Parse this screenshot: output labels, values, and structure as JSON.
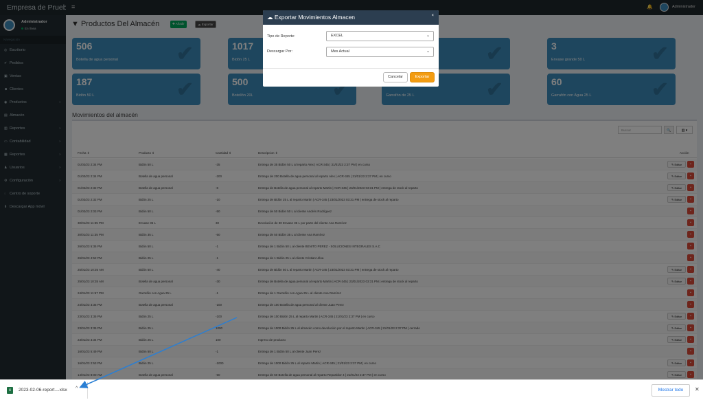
{
  "app": {
    "brand": "Empresa de Prueba",
    "user": "Administrador",
    "status": "En línea",
    "topbar_user": "Administrador"
  },
  "icons": {
    "menu": "menu-icon",
    "bell": "bell-icon",
    "check": "check-icon",
    "close": "close-icon",
    "excel": "excel-file-icon"
  },
  "colors": {
    "sidebar": "#222d32",
    "card": "#3c8dbc",
    "export": "#f39c12",
    "delete": "#dd4b39",
    "modal_header": "#2c3e50"
  },
  "sidebar": {
    "header": "Navegación",
    "items": [
      {
        "label": "Escritorio",
        "icon": "◎",
        "caret": ""
      },
      {
        "label": "Pedidos",
        "icon": "✔",
        "caret": ""
      },
      {
        "label": "Ventas",
        "icon": "▣",
        "caret": ""
      },
      {
        "label": "Clientes",
        "icon": "☻",
        "caret": ""
      },
      {
        "label": "Productos",
        "icon": "◉",
        "caret": "›"
      },
      {
        "label": "Almacén",
        "icon": "▤",
        "caret": ""
      },
      {
        "label": "Reportes",
        "icon": "▥",
        "caret": "›"
      },
      {
        "label": "Contabilidad",
        "icon": "▭",
        "caret": "›"
      },
      {
        "label": "Reportes",
        "icon": "▦",
        "caret": "›"
      },
      {
        "label": "Usuarios",
        "icon": "♟",
        "caret": "›"
      },
      {
        "label": "Configuración",
        "icon": "⚙",
        "caret": "›"
      },
      {
        "label": "Centro de soporte",
        "icon": "◌",
        "caret": ""
      },
      {
        "label": "Descargar App móvil",
        "icon": "⬇",
        "caret": ""
      }
    ]
  },
  "page": {
    "title": "Productos Del Almacén",
    "add_label": "✚ Añadir",
    "export_label": "☁ Exportar",
    "section_title": "Movimientos del almacén"
  },
  "cards": [
    {
      "value": "506",
      "label": "Botella de agua personal"
    },
    {
      "value": "1017",
      "label": "Bidón 25 L"
    },
    {
      "value": "",
      "label": ""
    },
    {
      "value": "3",
      "label": "Envase grande 50 L"
    },
    {
      "value": "187",
      "label": "Bidón 50 L"
    },
    {
      "value": "500",
      "label": "Botellón 20L"
    },
    {
      "value": "",
      "label": "Garrafón de 25 L"
    },
    {
      "value": "60",
      "label": "Garrafón con Agua 25 L"
    }
  ],
  "table": {
    "search_placeholder": "Buscar",
    "search_button": "🔍",
    "columns_button": "▥ ▾",
    "headers": {
      "fecha": "Fecha ⇕",
      "producto": "Producto ⇕",
      "cantidad": "Cantidad ⇕",
      "descripcion": "Descripcion ⇕",
      "accion": "Acción"
    },
    "edit_label": "✎ Editar",
    "delete_label": "▪",
    "rows": [
      {
        "fecha": "01/02/23 2:34 PM",
        "producto": "Bidón 50 L",
        "cantidad": "-35",
        "descripcion": "Entrega de 35 Bidón 50 L al reparto Alex | ACR-345 | 31/01/23 2:37 PM | en curso",
        "edit": true
      },
      {
        "fecha": "01/02/23 2:34 PM",
        "producto": "Botella de agua personal",
        "cantidad": "-200",
        "descripcion": "Entrega de 200 Botella de agua personal al reparto Alex | ACR-345 | 31/01/23 2:37 PM | en curso",
        "edit": true
      },
      {
        "fecha": "01/02/23 2:32 PM",
        "producto": "Botella de agua personal",
        "cantidad": "-8",
        "descripcion": "Entrega de Botella de agua personal al reparto Martin | ACR-345 | 23/01/2023 03:31 PM | entrega de stock al reparto",
        "edit": true
      },
      {
        "fecha": "01/02/23 2:32 PM",
        "producto": "Bidón 25 L",
        "cantidad": "-10",
        "descripcion": "Entrega de Bidón 25 L al reparto Martin | ACR-345 | 23/01/2023 03:31 PM | entrega de stock al reparto",
        "edit": true
      },
      {
        "fecha": "01/02/23 2:03 PM",
        "producto": "Bidón 50 L",
        "cantidad": "-50",
        "descripcion": "Entrega de 50 Bidón 50 L al cliente Andrés Rodríguez",
        "edit": false
      },
      {
        "fecha": "30/01/23 11:35 PM",
        "producto": "Envase 35 L",
        "cantidad": "30",
        "descripcion": "Devolución de 30 Envase 35 L por parte del cliente Ana Ramírez",
        "edit": false
      },
      {
        "fecha": "30/01/23 11:35 PM",
        "producto": "Bidón 35 L",
        "cantidad": "-50",
        "descripcion": "Entrega de 50 Bidón 35 L al cliente Ana Ramírez",
        "edit": false
      },
      {
        "fecha": "26/01/23 5:35 PM",
        "producto": "Bidón 50 L",
        "cantidad": "-1",
        "descripcion": "Entrega de 1 Bidón 50 L al cliente BENITO PEREZ - SOLUCIONES INTEGRALES S.A.C",
        "edit": false
      },
      {
        "fecha": "26/01/23 4:52 PM",
        "producto": "Bidón 25 L",
        "cantidad": "-1",
        "descripcion": "Entrega de 1 Bidón 25 L al cliente Cristian Ulloa",
        "edit": false
      },
      {
        "fecha": "25/01/23 10:35 AM",
        "producto": "Bidón 50 L",
        "cantidad": "-40",
        "descripcion": "Entrega de Bidón 50 L al reparto Martin | ACR-345 | 23/01/2023 03:31 PM | entrega de stock al reparto",
        "edit": true
      },
      {
        "fecha": "25/01/23 10:35 AM",
        "producto": "Botella de agua personal",
        "cantidad": "-30",
        "descripcion": "Entrega de Botella de agua personal al reparto Martin | ACR-345 | 23/01/2023 03:31 PM | entrega de stock al reparto",
        "edit": true
      },
      {
        "fecha": "24/01/23 11:57 PM",
        "producto": "Garrafón con Agua 25 L",
        "cantidad": "-1",
        "descripcion": "Entrega de 1 Garrafón con Agua 25 L al cliente Ana Ramírez",
        "edit": false
      },
      {
        "fecha": "24/01/23 3:35 PM",
        "producto": "Botella de agua personal",
        "cantidad": "-100",
        "descripcion": "Entrega de 100 Botella de agua personal al cliente Juan Perez",
        "edit": false
      },
      {
        "fecha": "23/01/23 3:35 PM",
        "producto": "Bidón 25 L",
        "cantidad": "-100",
        "descripcion": "Entrega de 100 Bidón 25 L al reparto Martin | ACR-345 | 21/01/23 2:37 PM | en curso",
        "edit": true
      },
      {
        "fecha": "23/01/23 3:35 PM",
        "producto": "Bidón 25 L",
        "cantidad": "1000",
        "descripcion": "Entrega de 1000 Bidón 25 L al almacén como devolución por el reparto Martin | ACR-345 | 21/01/23 2:37 PM | cerrado",
        "edit": true
      },
      {
        "fecha": "23/01/23 3:34 PM",
        "producto": "Bidón 25 L",
        "cantidad": "100",
        "descripcion": "Ingreso de producto",
        "edit": true
      },
      {
        "fecha": "16/01/23 5:49 PM",
        "producto": "Bidón 50 L",
        "cantidad": "-1",
        "descripcion": "Entrega de 1 Bidón 50 L al cliente Juan Perez",
        "edit": false
      },
      {
        "fecha": "16/01/23 2:53 PM",
        "producto": "Bidón 25 L",
        "cantidad": "-1000",
        "descripcion": "Entrega de 1000 Bidón 25 L al reparto Martin | ACR-345 | 21/01/23 2:37 PM | en curso",
        "edit": true
      },
      {
        "fecha": "14/01/23 8:00 AM",
        "producto": "Botella de agua personal",
        "cantidad": "-50",
        "descripcion": "Entrega de 50 Botella de agua personal al reparto Repartidor 4 | 21/01/23 2:37 PM | en curso",
        "edit": true
      }
    ]
  },
  "modal": {
    "title": "Exportar Movimientos Almacen",
    "close": "×",
    "tipo_label": "Tipo de Reporte:",
    "tipo_value": "EXCEL",
    "descargar_label": "Descargar Por:",
    "descargar_value": "Mes Actual",
    "cancel_label": "Cancelar",
    "export_label": "Exportar"
  },
  "download": {
    "file": "2023-02-06-report....xlsx",
    "caret": "^",
    "show_all": "Mostrar todo",
    "close": "✕"
  }
}
